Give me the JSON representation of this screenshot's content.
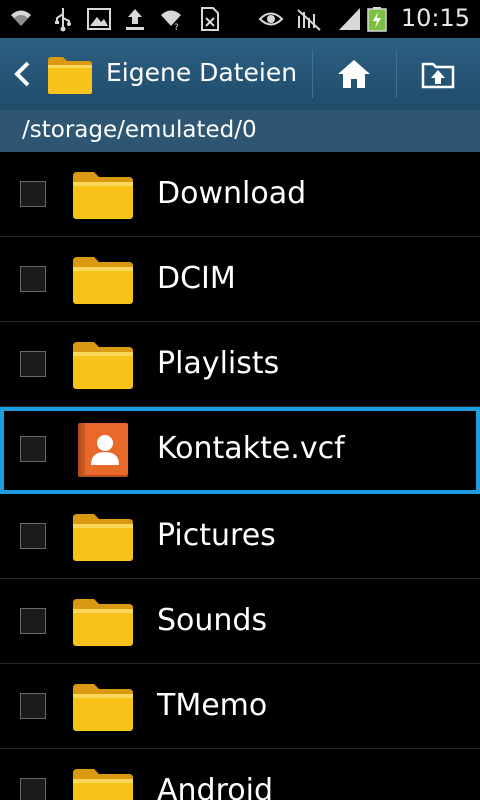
{
  "status_bar": {
    "time": "10:15",
    "icons": [
      "wifi-icon",
      "usb-icon",
      "image-icon",
      "upload-icon",
      "wifi-alt-icon",
      "sim-icon",
      "eye-icon",
      "no-signal-icon",
      "signal-icon",
      "battery-charging-icon"
    ]
  },
  "action_bar": {
    "title": "Eigene Dateien",
    "home_icon": "home-icon",
    "up_icon": "folder-up-icon"
  },
  "path": "/storage/emulated/0",
  "files": [
    {
      "name": "Download",
      "type": "folder",
      "selected": false
    },
    {
      "name": "DCIM",
      "type": "folder",
      "selected": false
    },
    {
      "name": "Playlists",
      "type": "folder",
      "selected": false
    },
    {
      "name": "Kontakte.vcf",
      "type": "contact-file",
      "selected": true
    },
    {
      "name": "Pictures",
      "type": "folder",
      "selected": false
    },
    {
      "name": "Sounds",
      "type": "folder",
      "selected": false
    },
    {
      "name": "TMemo",
      "type": "folder",
      "selected": false
    },
    {
      "name": "Android",
      "type": "folder",
      "selected": false
    }
  ],
  "colors": {
    "action_bar": "#245673",
    "path_bar": "#2e5672",
    "selection": "#1e9ce0",
    "folder": "#f7c21a",
    "contact_icon": "#e8692a"
  }
}
